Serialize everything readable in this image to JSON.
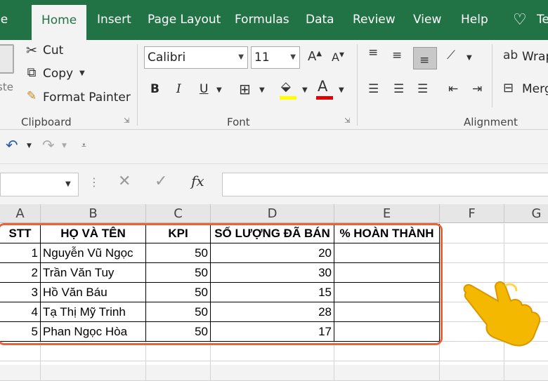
{
  "tabs": [
    {
      "label": "le"
    },
    {
      "label": "Home"
    },
    {
      "label": "Insert"
    },
    {
      "label": "Page Layout"
    },
    {
      "label": "Formulas"
    },
    {
      "label": "Data"
    },
    {
      "label": "Review"
    },
    {
      "label": "View"
    },
    {
      "label": "Help"
    },
    {
      "label": "Te"
    }
  ],
  "clipboard": {
    "cut": "Cut",
    "copy": "Copy",
    "format_painter": "Format Painter",
    "paste_partial": "ste",
    "label": "Clipboard"
  },
  "font": {
    "name": "Calibri",
    "size": "11",
    "label": "Font",
    "bold": "B",
    "italic": "I",
    "underline": "U"
  },
  "alignment": {
    "wrap": "Wrap",
    "merge": "Merg",
    "label": "Alignment"
  },
  "formula_bar": {
    "fx": "fx",
    "value": ""
  },
  "columns": [
    "A",
    "B",
    "C",
    "D",
    "E",
    "F",
    "G"
  ],
  "headers": [
    "STT",
    "HỌ VÀ TÊN",
    "KPI",
    "SỐ LƯỢNG ĐÃ BÁN",
    "% HOÀN THÀNH"
  ],
  "rows": [
    {
      "stt": "1",
      "name": "Nguyễn Vũ Ngọc",
      "kpi": "50",
      "sold": "20",
      "pct": ""
    },
    {
      "stt": "2",
      "name": "Trần Văn Tuy",
      "kpi": "50",
      "sold": "30",
      "pct": ""
    },
    {
      "stt": "3",
      "name": "Hồ Văn Báu",
      "kpi": "50",
      "sold": "15",
      "pct": ""
    },
    {
      "stt": "4",
      "name": "Tạ Thị Mỹ Trinh",
      "kpi": "50",
      "sold": "28",
      "pct": ""
    },
    {
      "stt": "5",
      "name": "Phan Ngọc Hòa",
      "kpi": "50",
      "sold": "17",
      "pct": ""
    }
  ],
  "colors": {
    "brand": "#217346",
    "highlight": "#e8623c",
    "hand": "#f5b800"
  }
}
